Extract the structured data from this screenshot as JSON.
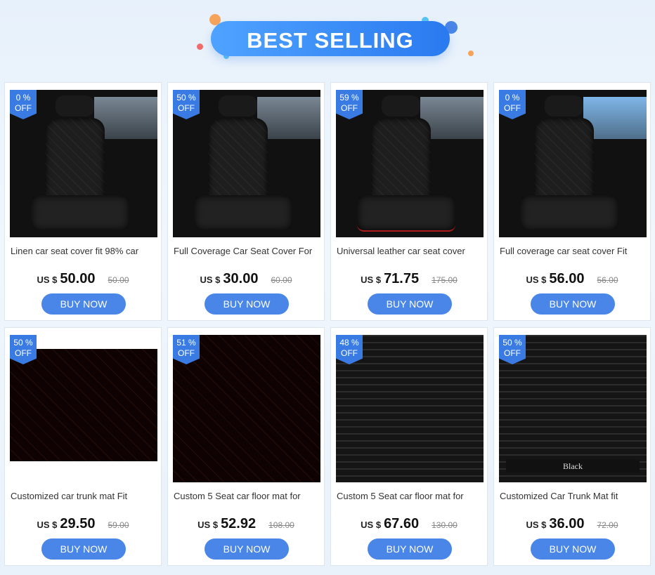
{
  "header": {
    "title": "BEST SELLING"
  },
  "products": [
    {
      "discount_pct": "0 %",
      "discount_off": "OFF",
      "title": "Linen car seat cover fit 98% car",
      "currency": "US $",
      "price": "50.00",
      "old_price": "50.00",
      "button": "BUY NOW",
      "image": "linen-seat-cover"
    },
    {
      "discount_pct": "50 %",
      "discount_off": "OFF",
      "title": "Full Coverage Car Seat Cover For",
      "currency": "US $",
      "price": "30.00",
      "old_price": "60.00",
      "button": "BUY NOW",
      "image": "full-coverage-seat-cover"
    },
    {
      "discount_pct": "59 %",
      "discount_off": "OFF",
      "title": "Universal leather car seat cover",
      "currency": "US $",
      "price": "71.75",
      "old_price": "175.00",
      "button": "BUY NOW",
      "image": "leather-seat-cover"
    },
    {
      "discount_pct": "0 %",
      "discount_off": "OFF",
      "title": "Full coverage car seat cover Fit",
      "currency": "US $",
      "price": "56.00",
      "old_price": "56.00",
      "button": "BUY NOW",
      "image": "seat-cover-with-pillows"
    },
    {
      "discount_pct": "50 %",
      "discount_off": "OFF",
      "title": "Customized car trunk mat Fit",
      "currency": "US $",
      "price": "29.50",
      "old_price": "59.00",
      "button": "BUY NOW",
      "image": "quilted-trunk-mat"
    },
    {
      "discount_pct": "51 %",
      "discount_off": "OFF",
      "title": "Custom 5 Seat car floor mat for",
      "currency": "US $",
      "price": "52.92",
      "old_price": "108.00",
      "button": "BUY NOW",
      "image": "brown-floor-mat"
    },
    {
      "discount_pct": "48 %",
      "discount_off": "OFF",
      "title": "Custom 5 Seat car floor mat for",
      "currency": "US $",
      "price": "67.60",
      "old_price": "130.00",
      "button": "BUY NOW",
      "image": "black-floor-mat"
    },
    {
      "discount_pct": "50 %",
      "discount_off": "OFF",
      "title": "Customized Car Trunk Mat fit",
      "currency": "US $",
      "price": "36.00",
      "old_price": "72.00",
      "button": "BUY NOW",
      "image": "striped-trunk-mat",
      "image_label": "Black"
    }
  ]
}
